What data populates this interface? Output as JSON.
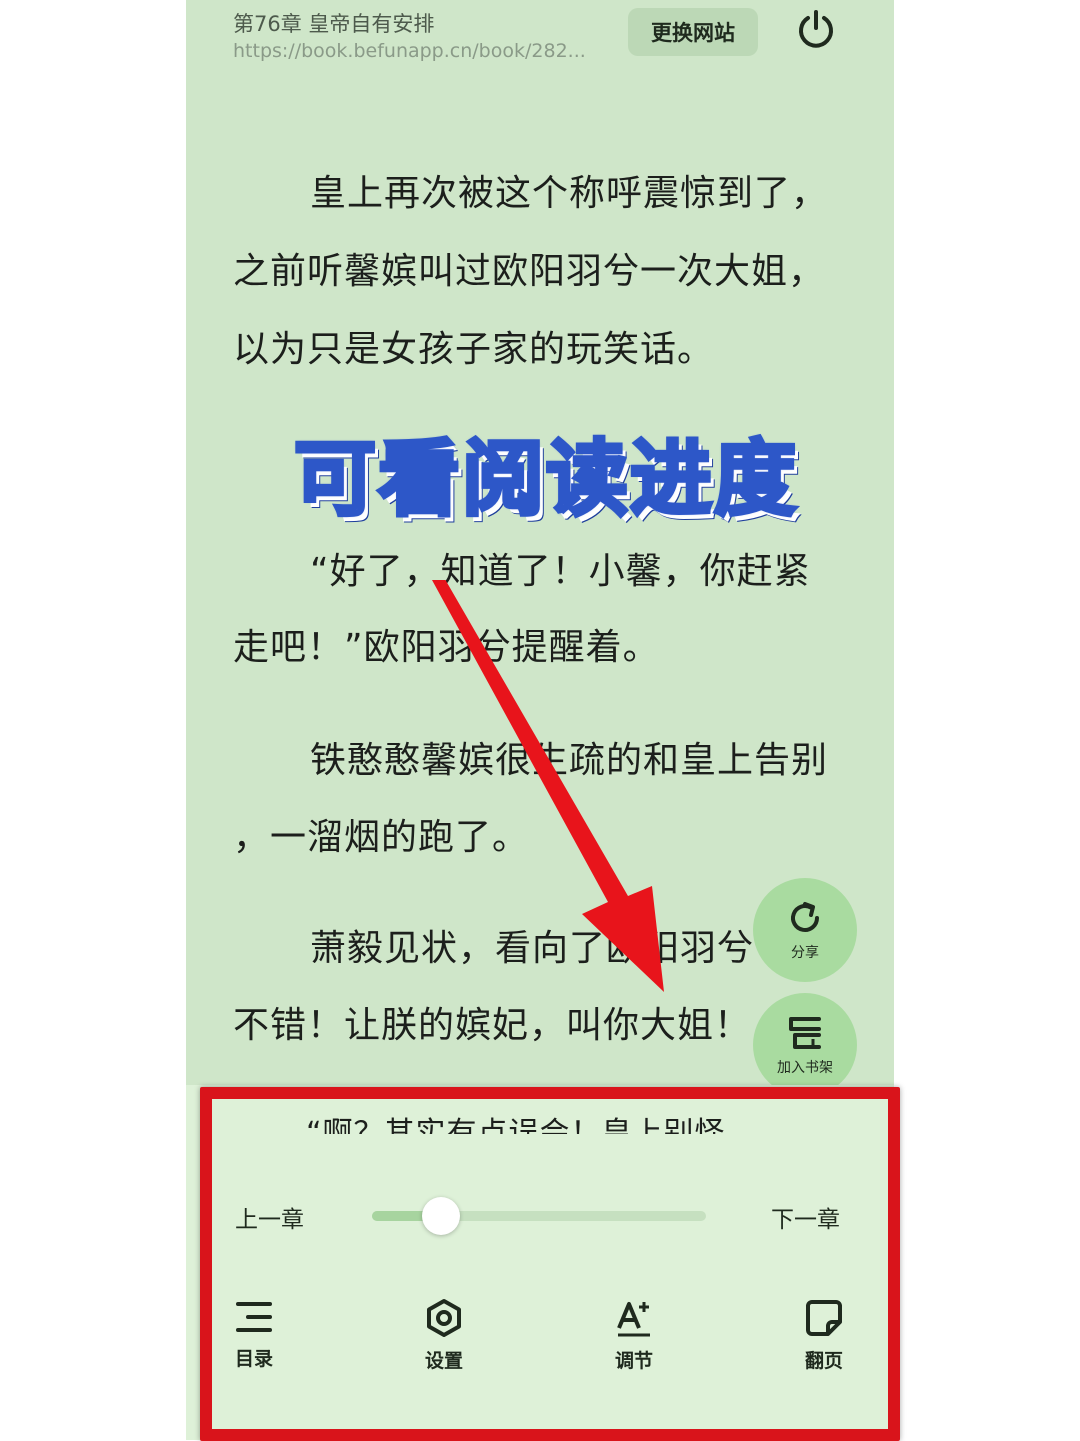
{
  "header": {
    "chapter_title": "第76章 皇帝自有安排",
    "chapter_url": "https://book.befunapp.cn/book/282...",
    "change_site_label": "更换网站",
    "power_icon": "power-icon"
  },
  "story": {
    "lines": [
      "皇上再次被这个称呼震惊到了，",
      "之前听馨嫔叫过欧阳羽兮一次大姐，",
      "以为只是女孩子家的玩笑话。",
      "“好了，知道了！小馨，你赶紧",
      "走吧！”欧阳羽兮提醒着。",
      "铁憨憨馨嫔很生疏的和皇上告别",
      "，一溜烟的跑了。",
      "萧毅见状，看向了欧阳羽兮",
      "不错！让朕的嫔妃，叫你大姐！"
    ],
    "partial_line": "“啊？其实有点误会！皇上别怪"
  },
  "overlay": {
    "title": "可看阅读进度",
    "arrow_color": "#e8141b"
  },
  "fabs": {
    "share_label": "分享",
    "bookshelf_label": "加入书架"
  },
  "panel": {
    "prev_chapter": "上一章",
    "next_chapter": "下一章",
    "progress": 0.15,
    "tools": [
      {
        "label": "目录",
        "icon": "list-icon"
      },
      {
        "label": "设置",
        "icon": "settings-icon"
      },
      {
        "label": "调节",
        "icon": "font-adjust-icon"
      },
      {
        "label": "翻页",
        "icon": "page-turn-icon"
      }
    ],
    "highlight_color": "#d9141b"
  }
}
